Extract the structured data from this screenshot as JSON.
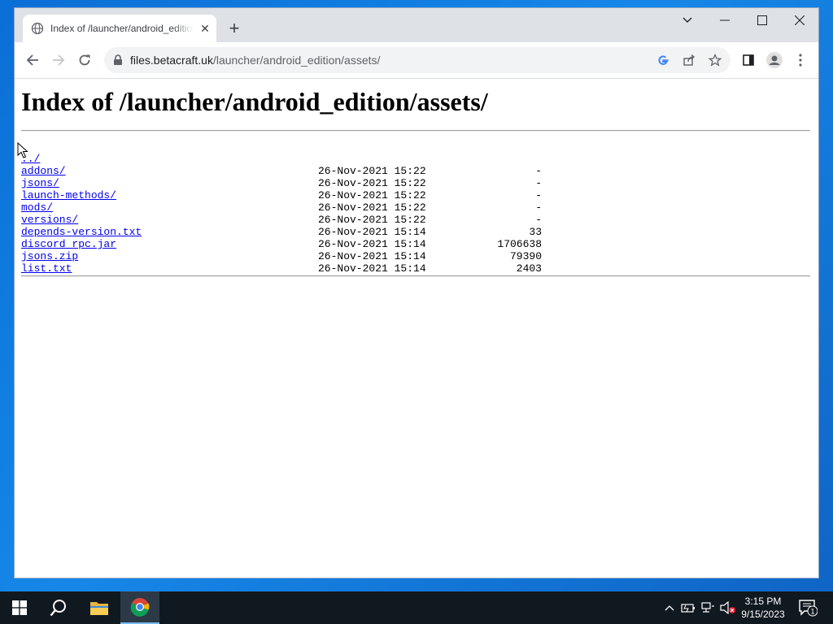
{
  "browser": {
    "tab_title": "Index of /launcher/android_edition/assets/",
    "url_host": "files.betacraft.uk",
    "url_path": "/launcher/android_edition/assets/"
  },
  "page": {
    "heading": "Index of /launcher/android_edition/assets/",
    "entries": [
      {
        "name": "../",
        "date": "",
        "size": ""
      },
      {
        "name": "addons/",
        "date": "26-Nov-2021 15:22",
        "size": "-"
      },
      {
        "name": "jsons/",
        "date": "26-Nov-2021 15:22",
        "size": "-"
      },
      {
        "name": "launch-methods/",
        "date": "26-Nov-2021 15:22",
        "size": "-"
      },
      {
        "name": "mods/",
        "date": "26-Nov-2021 15:22",
        "size": "-"
      },
      {
        "name": "versions/",
        "date": "26-Nov-2021 15:22",
        "size": "-"
      },
      {
        "name": "depends-version.txt",
        "date": "26-Nov-2021 15:14",
        "size": "33"
      },
      {
        "name": "discord_rpc.jar",
        "date": "26-Nov-2021 15:14",
        "size": "1706638"
      },
      {
        "name": "jsons.zip",
        "date": "26-Nov-2021 15:14",
        "size": "79390"
      },
      {
        "name": "list.txt",
        "date": "26-Nov-2021 15:14",
        "size": "2403"
      }
    ]
  },
  "taskbar": {
    "time": "3:15 PM",
    "date": "9/15/2023",
    "notification_count": "1"
  },
  "colors": {
    "link": "#0000ee",
    "desktop": "#0a6fd6",
    "taskbar": "#101820"
  }
}
